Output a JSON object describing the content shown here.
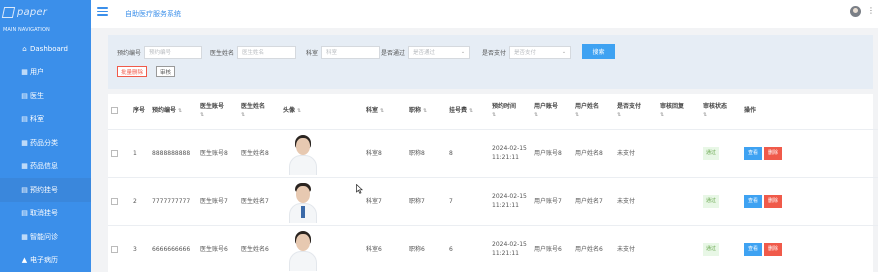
{
  "logo": {
    "text": "paper"
  },
  "header": {
    "title": "自助医疗服务系统",
    "more_icon": "⋮"
  },
  "sidebar": {
    "section_title": "MAIN NAVIGATION",
    "items": [
      {
        "label": "Dashboard",
        "icon": "home-icon",
        "glyph": "⌂"
      },
      {
        "label": "用户",
        "icon": "grid-icon",
        "glyph": "▦"
      },
      {
        "label": "医生",
        "icon": "file-icon",
        "glyph": "▤"
      },
      {
        "label": "科室",
        "icon": "file-icon",
        "glyph": "▤"
      },
      {
        "label": "药品分类",
        "icon": "grid-icon",
        "glyph": "▦"
      },
      {
        "label": "药品信息",
        "icon": "grid-icon",
        "glyph": "▦"
      },
      {
        "label": "预约挂号",
        "icon": "file-icon",
        "glyph": "▤",
        "active": true
      },
      {
        "label": "取消挂号",
        "icon": "file-icon",
        "glyph": "▤"
      },
      {
        "label": "智能问诊",
        "icon": "grid-icon",
        "glyph": "▦"
      },
      {
        "label": "电子病历",
        "icon": "user-icon",
        "glyph": "▲"
      }
    ]
  },
  "search": {
    "order_no": {
      "label": "预约编号",
      "placeholder": "预约编号"
    },
    "doctor_name": {
      "label": "医生姓名",
      "placeholder": "医生姓名"
    },
    "department": {
      "label": "科室",
      "placeholder": "科室"
    },
    "approved": {
      "label": "是否通过",
      "placeholder": "是否通过"
    },
    "paid": {
      "label": "是否支付",
      "placeholder": "是否支付"
    },
    "caret": "⌄",
    "search_button": "搜索",
    "bulk_delete_button": "批量删除",
    "review_button": "审核"
  },
  "table": {
    "headers": {
      "index": "序号",
      "order_no": "预约编号",
      "doctor_account": "医生账号",
      "doctor_name": "医生姓名",
      "avatar": "头像",
      "department": "科室",
      "title": "职称",
      "fee": "挂号费",
      "time": "预约时间",
      "user_account": "用户账号",
      "user_name": "用户姓名",
      "paid": "是否支付",
      "review_reply": "审核回复",
      "review_status": "审核状态",
      "actions": "操作"
    },
    "sort_glyph": "⇅",
    "rows": [
      {
        "index": "1",
        "order_no": "8888888888",
        "doctor_account": "医生账号8",
        "doctor_name": "医生姓名8",
        "avatar": "female",
        "department": "科室8",
        "title": "职称8",
        "fee": "8",
        "date": "2024-02-15",
        "clock": "11:21:11",
        "user_account": "用户账号8",
        "user_name": "用户姓名8",
        "paid": "未支付",
        "review_reply": "",
        "review_status": "通过",
        "view": "查看",
        "delete": "删除"
      },
      {
        "index": "2",
        "order_no": "7777777777",
        "doctor_account": "医生账号7",
        "doctor_name": "医生姓名7",
        "avatar": "male",
        "department": "科室7",
        "title": "职称7",
        "fee": "7",
        "date": "2024-02-15",
        "clock": "11:21:11",
        "user_account": "用户账号7",
        "user_name": "用户姓名7",
        "paid": "未支付",
        "review_reply": "",
        "review_status": "通过",
        "view": "查看",
        "delete": "删除"
      },
      {
        "index": "3",
        "order_no": "6666666666",
        "doctor_account": "医生账号6",
        "doctor_name": "医生姓名6",
        "avatar": "female",
        "department": "科室6",
        "title": "职称6",
        "fee": "6",
        "date": "2024-02-15",
        "clock": "11:21:11",
        "user_account": "用户账号6",
        "user_name": "用户姓名6",
        "paid": "未支付",
        "review_reply": "",
        "review_status": "通过",
        "view": "查看",
        "delete": "删除"
      }
    ]
  },
  "colors": {
    "sidebar": "#3b8fea",
    "accent": "#3ea2f2",
    "danger": "#f05a4a",
    "success": "#6aa84f"
  }
}
